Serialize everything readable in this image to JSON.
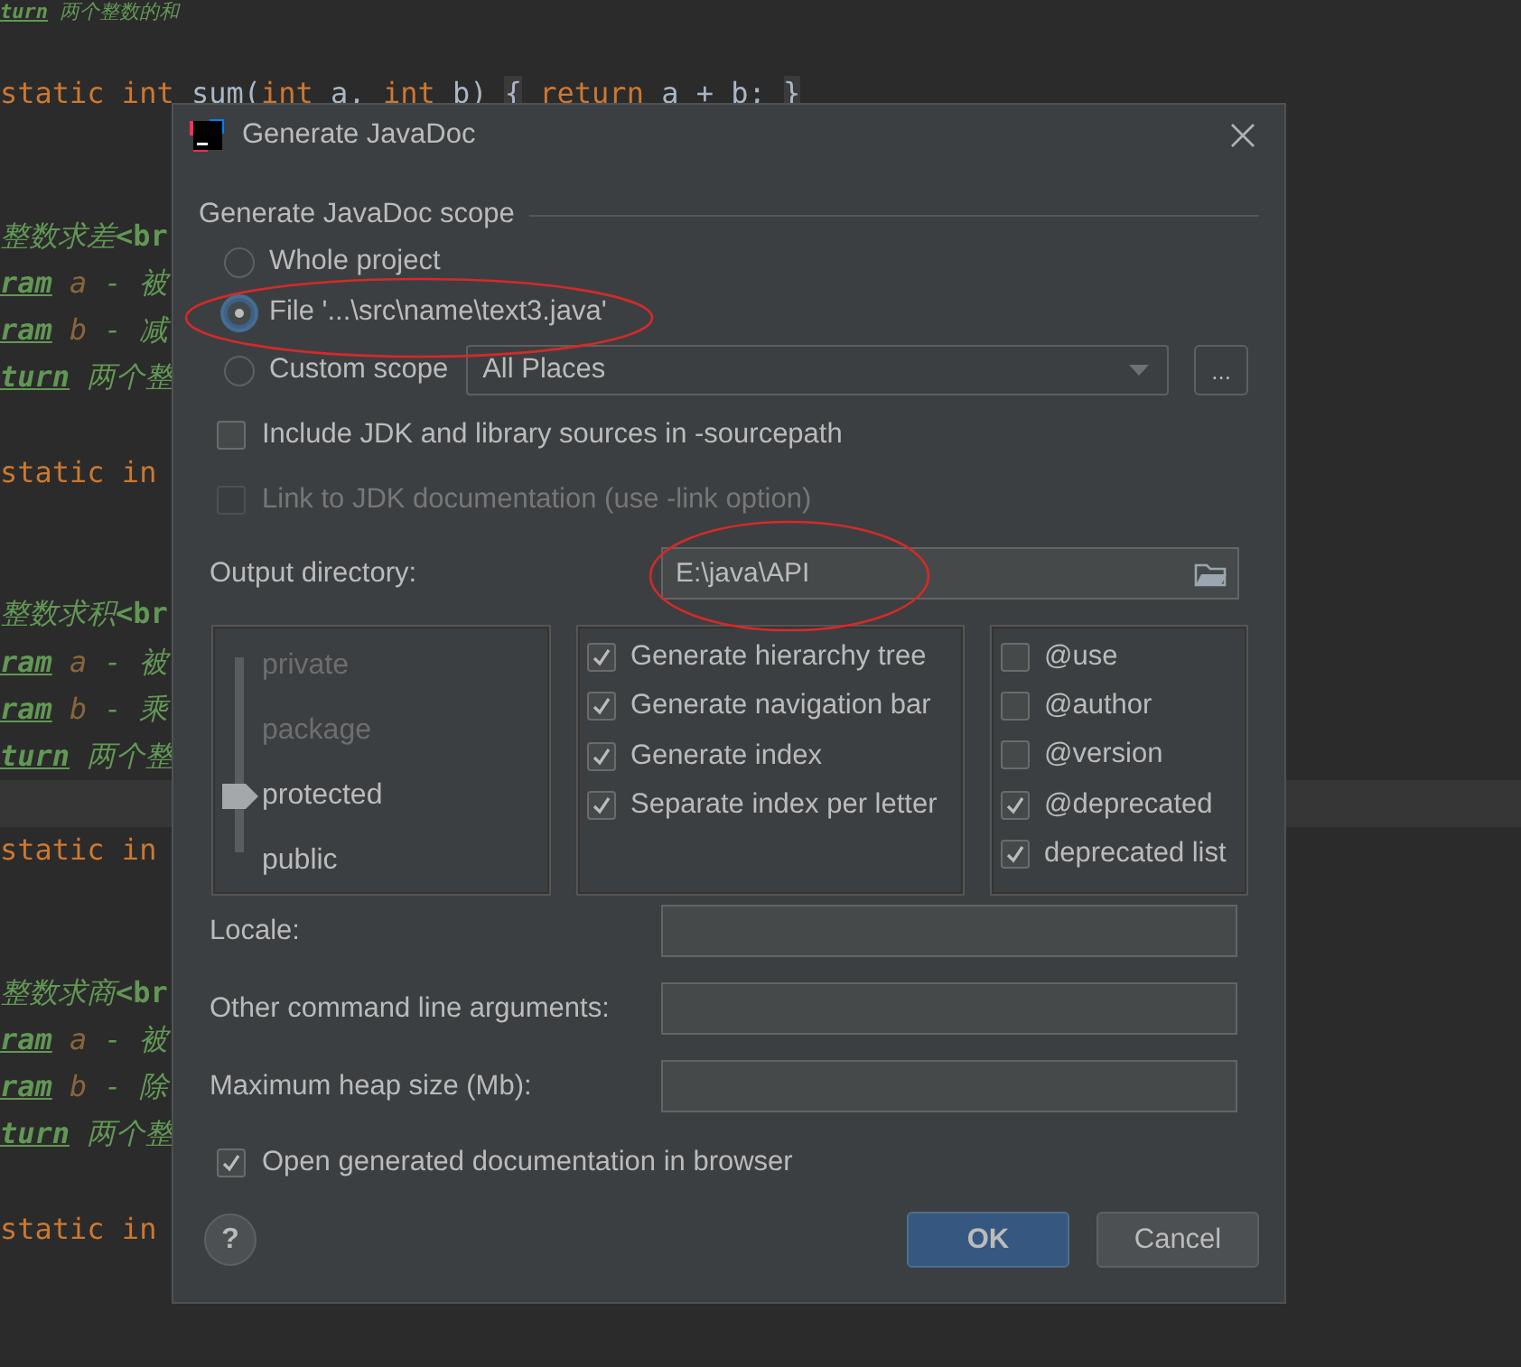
{
  "editor": {
    "lines": [
      {
        "kind": "code",
        "tokens": [
          {
            "kind": "tag",
            "text": "turn"
          },
          {
            "kind": "doc",
            "text": " 两个整数的和"
          }
        ]
      },
      {
        "kind": "blank"
      },
      {
        "kind": "code",
        "tokens": [
          {
            "kind": "keyword",
            "text": "static"
          },
          {
            "kind": "keyword",
            "text": " int"
          },
          {
            "kind": "plain",
            "text": " sum("
          },
          {
            "kind": "keyword",
            "text": "int"
          },
          {
            "kind": "plain",
            "text": " a, "
          },
          {
            "kind": "keyword",
            "text": "int"
          },
          {
            "kind": "plain",
            "text": " b) "
          },
          {
            "kind": "fold",
            "text": "{"
          },
          {
            "kind": "keyword",
            "text": " return"
          },
          {
            "kind": "plain",
            "text": " a + b; "
          },
          {
            "kind": "fold",
            "text": "}"
          }
        ]
      },
      {
        "kind": "blank"
      },
      {
        "kind": "blank"
      },
      {
        "kind": "code",
        "tokens": [
          {
            "kind": "doc",
            "text": "整数求差"
          },
          {
            "kind": "html",
            "text": "<br"
          }
        ]
      },
      {
        "kind": "code",
        "tokens": [
          {
            "kind": "tag",
            "text": "ram"
          },
          {
            "kind": "param",
            "text": " a"
          },
          {
            "kind": "doc",
            "text": " - 被"
          }
        ]
      },
      {
        "kind": "code",
        "tokens": [
          {
            "kind": "tag",
            "text": "ram"
          },
          {
            "kind": "param",
            "text": " b"
          },
          {
            "kind": "doc",
            "text": " - 减"
          }
        ]
      },
      {
        "kind": "code",
        "tokens": [
          {
            "kind": "tag",
            "text": "turn"
          },
          {
            "kind": "doc",
            "text": " 两个整"
          }
        ]
      },
      {
        "kind": "blank"
      },
      {
        "kind": "code",
        "tokens": [
          {
            "kind": "keyword",
            "text": "static"
          },
          {
            "kind": "keyword",
            "text": " in"
          }
        ]
      },
      {
        "kind": "blank"
      },
      {
        "kind": "blank"
      },
      {
        "kind": "code",
        "tokens": [
          {
            "kind": "doc",
            "text": "整数求积"
          },
          {
            "kind": "html",
            "text": "<br"
          }
        ]
      },
      {
        "kind": "code",
        "tokens": [
          {
            "kind": "tag",
            "text": "ram"
          },
          {
            "kind": "param",
            "text": " a"
          },
          {
            "kind": "doc",
            "text": " - 被"
          }
        ]
      },
      {
        "kind": "code",
        "tokens": [
          {
            "kind": "tag",
            "text": "ram"
          },
          {
            "kind": "param",
            "text": " b"
          },
          {
            "kind": "doc",
            "text": " - 乘"
          }
        ]
      },
      {
        "kind": "code",
        "tokens": [
          {
            "kind": "tag",
            "text": "turn"
          },
          {
            "kind": "doc",
            "text": " 两个整"
          }
        ]
      },
      {
        "kind": "current"
      },
      {
        "kind": "code",
        "tokens": [
          {
            "kind": "keyword",
            "text": "static"
          },
          {
            "kind": "keyword",
            "text": " in"
          }
        ]
      },
      {
        "kind": "blank"
      },
      {
        "kind": "blank"
      },
      {
        "kind": "code",
        "tokens": [
          {
            "kind": "doc",
            "text": "整数求商"
          },
          {
            "kind": "html",
            "text": "<br"
          }
        ]
      },
      {
        "kind": "code",
        "tokens": [
          {
            "kind": "tag",
            "text": "ram"
          },
          {
            "kind": "param",
            "text": " a"
          },
          {
            "kind": "doc",
            "text": " - 被"
          }
        ]
      },
      {
        "kind": "code",
        "tokens": [
          {
            "kind": "tag",
            "text": "ram"
          },
          {
            "kind": "param",
            "text": " b"
          },
          {
            "kind": "doc",
            "text": " - 除"
          }
        ]
      },
      {
        "kind": "code",
        "tokens": [
          {
            "kind": "tag",
            "text": "turn"
          },
          {
            "kind": "doc",
            "text": " 两个整"
          }
        ]
      },
      {
        "kind": "blank"
      },
      {
        "kind": "code",
        "tokens": [
          {
            "kind": "keyword",
            "text": "static"
          },
          {
            "kind": "keyword",
            "text": " in"
          }
        ]
      }
    ]
  },
  "dialog": {
    "title": "Generate JavaDoc",
    "scope": {
      "heading": "Generate JavaDoc scope",
      "options": [
        {
          "label": "Whole project",
          "selected": false
        },
        {
          "label": "File '...\\src\\name\\text3.java'",
          "selected": true
        },
        {
          "label": "Custom scope",
          "selected": false,
          "dropdown": {
            "value": "All Places"
          },
          "button": "..."
        }
      ]
    },
    "options": [
      {
        "label": "Include JDK and library sources in -sourcepath",
        "checked": false,
        "disabled": false
      },
      {
        "label": "Link to JDK documentation (use -link option)",
        "checked": false,
        "disabled": true
      }
    ],
    "output_directory": {
      "label": "Output directory:",
      "value": "E:\\java\\API"
    },
    "visibility": [
      {
        "label": "private",
        "selected": false
      },
      {
        "label": "package",
        "selected": false
      },
      {
        "label": "protected",
        "selected": true
      },
      {
        "label": "public",
        "selected": false
      }
    ],
    "generate_options": [
      {
        "label": "Generate hierarchy tree",
        "checked": true
      },
      {
        "label": "Generate navigation bar",
        "checked": true
      },
      {
        "label": "Generate index",
        "checked": true
      },
      {
        "label": "Separate index per letter",
        "checked": true
      }
    ],
    "tags": [
      {
        "label": "@use",
        "checked": false
      },
      {
        "label": "@author",
        "checked": false
      },
      {
        "label": "@version",
        "checked": false
      },
      {
        "label": "@deprecated",
        "checked": true
      },
      {
        "label": "deprecated list",
        "checked": true
      }
    ],
    "fields": [
      {
        "label": "Locale:"
      },
      {
        "label": "Other command line arguments:"
      },
      {
        "label": "Maximum heap size (Mb):"
      }
    ],
    "open_in_browser": {
      "label": "Open generated documentation in browser",
      "checked": true
    },
    "help_button": "?",
    "buttons": [
      {
        "label": "OK",
        "kind": "primary"
      },
      {
        "label": "Cancel",
        "kind": "secondary"
      }
    ]
  }
}
